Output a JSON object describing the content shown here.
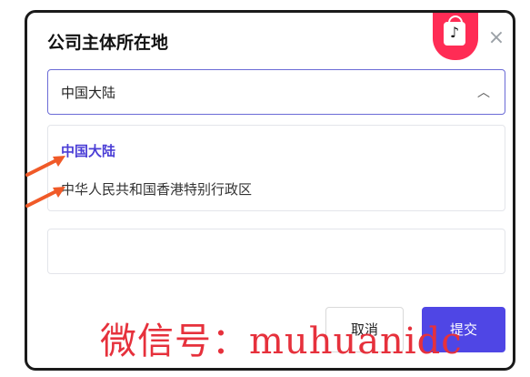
{
  "dialog": {
    "title": "公司主体所在地",
    "close_glyph": "×",
    "brand": {
      "icon": "tiktok-shop-bag-icon",
      "color": "#ff2c55",
      "glyph": "♪"
    }
  },
  "select": {
    "value": "中国大陆",
    "chevron": "︿",
    "border_color": "#6b6bd6",
    "options": [
      {
        "label": "中国大陆",
        "selected": true
      },
      {
        "label": "中华人民共和国香港特别行政区",
        "selected": false
      }
    ]
  },
  "empty_input": {
    "value": ""
  },
  "buttons": {
    "cancel": "取消",
    "submit": "提交",
    "submit_color": "#4f46e5"
  },
  "annotation": {
    "arrow_color": "#f05a28",
    "watermark": "微信号：muhuanidc",
    "watermark_color": "#e6313c"
  }
}
